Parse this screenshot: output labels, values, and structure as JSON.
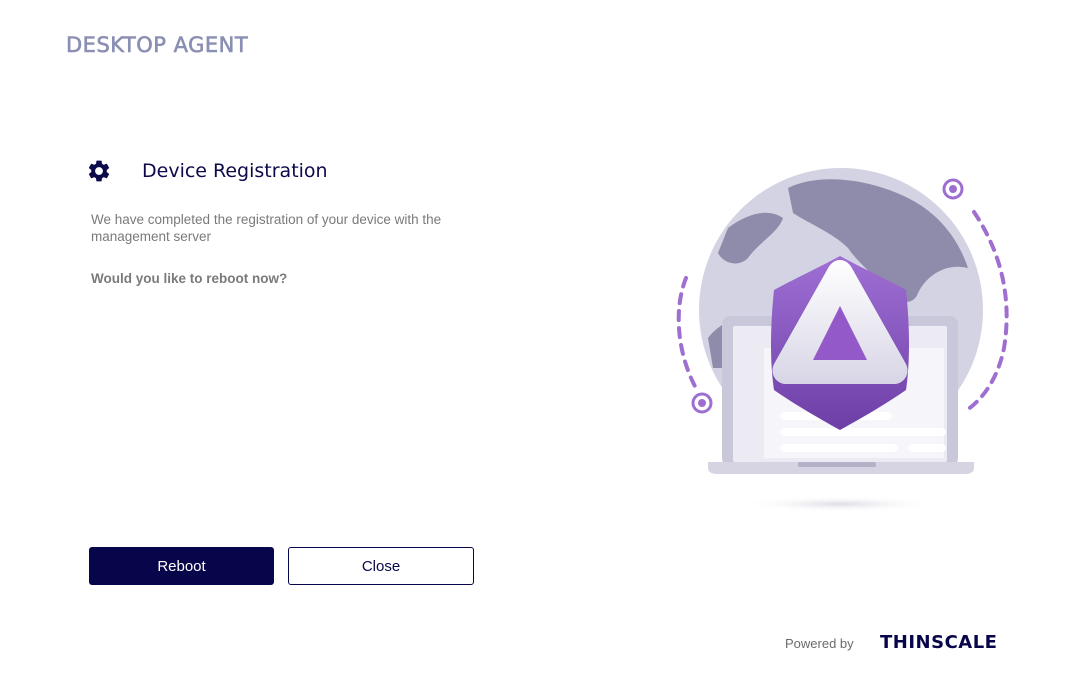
{
  "app": {
    "title": "DESKTOP AGENT"
  },
  "dialog": {
    "title": "Device Registration",
    "title_icon": "gear-icon",
    "message": "We have completed the registration of your device with the management server",
    "question": "Would you like to reboot now?"
  },
  "buttons": {
    "reboot_label": "Reboot",
    "close_label": "Close"
  },
  "footer": {
    "powered_by": "Powered by",
    "brand": "THINSCALE"
  },
  "colors": {
    "primary": "#08064a",
    "logo": "#8a8fb3",
    "accent_purple": "#8e5cc4",
    "text_muted": "#7a7a7a"
  },
  "illustration": {
    "icon": "shield-laptop-globe-illustration"
  }
}
